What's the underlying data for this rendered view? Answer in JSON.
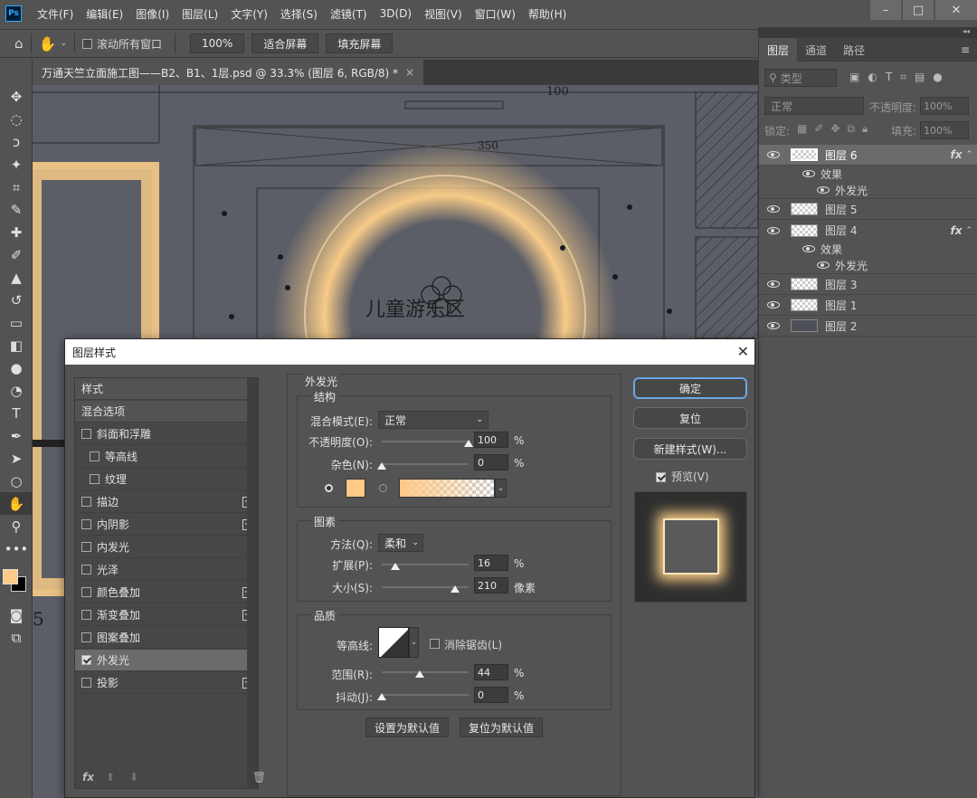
{
  "app": {
    "logo": "Ps"
  },
  "menu": [
    "文件(F)",
    "编辑(E)",
    "图像(I)",
    "图层(L)",
    "文字(Y)",
    "选择(S)",
    "滤镜(T)",
    "3D(D)",
    "视图(V)",
    "窗口(W)",
    "帮助(H)"
  ],
  "window_controls": {
    "minimize": "–",
    "restore": "□",
    "close": "✕"
  },
  "options_bar": {
    "scroll_all": "滚动所有窗口",
    "zoom_value": "100%",
    "fit_screen": "适合屏幕",
    "fill_screen": "填充屏幕"
  },
  "document_tab": {
    "title": "万通天竺立面施工图——B2、B1、1层.psd @ 33.3% (图层 6, RGB/8) *",
    "close": "×"
  },
  "canvas": {
    "dim_100": "100",
    "dim_350": "350",
    "room_label": "儿童游乐区",
    "left_digit": "5"
  },
  "colors": {
    "glow": "#ffd08a",
    "fg_swatch": "#ffc987",
    "bg_swatch": "#000000",
    "ok_border": "#6aa6e8"
  },
  "layers_panel": {
    "tabs": [
      "图层",
      "通道",
      "路径"
    ],
    "search_placeholder": "类型",
    "blend_mode": "正常",
    "opacity_label": "不透明度:",
    "opacity_value": "100%",
    "lock_label": "锁定:",
    "fill_label": "填充:",
    "fill_value": "100%",
    "fx": "fx",
    "layers": [
      {
        "name": "图层 6",
        "has_fx": true,
        "selected": true
      },
      {
        "name": "效果",
        "kind": "effects-header"
      },
      {
        "name": "外发光",
        "kind": "effect"
      },
      {
        "name": "图层 5",
        "has_fx": false
      },
      {
        "name": "图层 4",
        "has_fx": true
      },
      {
        "name": "效果",
        "kind": "effects-header"
      },
      {
        "name": "外发光",
        "kind": "effect"
      },
      {
        "name": "图层 3",
        "has_fx": false
      },
      {
        "name": "图层 1",
        "has_fx": false
      },
      {
        "name": "图层 2",
        "has_fx": false
      }
    ]
  },
  "dialog": {
    "title": "图层样式",
    "close": "✕",
    "styles": [
      {
        "label": "样式",
        "checkbox": false
      },
      {
        "label": "混合选项",
        "checkbox": false
      },
      {
        "label": "斜面和浮雕",
        "checkbox": true,
        "checked": false
      },
      {
        "label": "等高线",
        "checkbox": true,
        "checked": false,
        "indent": true
      },
      {
        "label": "纹理",
        "checkbox": true,
        "checked": false,
        "indent": true
      },
      {
        "label": "描边",
        "checkbox": true,
        "checked": false,
        "plus": true
      },
      {
        "label": "内阴影",
        "checkbox": true,
        "checked": false,
        "plus": true
      },
      {
        "label": "内发光",
        "checkbox": true,
        "checked": false
      },
      {
        "label": "光泽",
        "checkbox": true,
        "checked": false
      },
      {
        "label": "颜色叠加",
        "checkbox": true,
        "checked": false,
        "plus": true
      },
      {
        "label": "渐变叠加",
        "checkbox": true,
        "checked": false,
        "plus": true
      },
      {
        "label": "图案叠加",
        "checkbox": true,
        "checked": false
      },
      {
        "label": "外发光",
        "checkbox": true,
        "checked": true,
        "selected": true
      },
      {
        "label": "投影",
        "checkbox": true,
        "checked": false,
        "plus": true
      }
    ],
    "list_footer": {
      "fx": "fx"
    },
    "outer_glow": {
      "section_title": "外发光",
      "structure": {
        "title": "结构",
        "blend_mode_label": "混合模式(E):",
        "blend_mode": "正常",
        "opacity_label": "不透明度(O):",
        "opacity": "100",
        "noise_label": "杂色(N):",
        "noise": "0",
        "percent": "%",
        "opacity_level": 100,
        "noise_level": 0
      },
      "elements": {
        "title": "图素",
        "technique_label": "方法(Q):",
        "technique": "柔和",
        "spread_label": "扩展(P):",
        "spread": "16",
        "size_label": "大小(S):",
        "size": "210",
        "percent": "%",
        "pixels": "像素",
        "spread_level": 16,
        "size_level": 84
      },
      "quality": {
        "title": "品质",
        "contour_label": "等高线:",
        "anti_alias_label": "消除锯齿(L)",
        "range_label": "范围(R):",
        "range": "44",
        "jitter_label": "抖动(J):",
        "jitter": "0",
        "percent": "%",
        "range_level": 44,
        "jitter_level": 0
      },
      "make_default": "设置为默认值",
      "reset_default": "复位为默认值"
    },
    "buttons": {
      "ok": "确定",
      "reset": "复位",
      "new_style": "新建样式(W)...",
      "preview": "预览(V)"
    }
  }
}
